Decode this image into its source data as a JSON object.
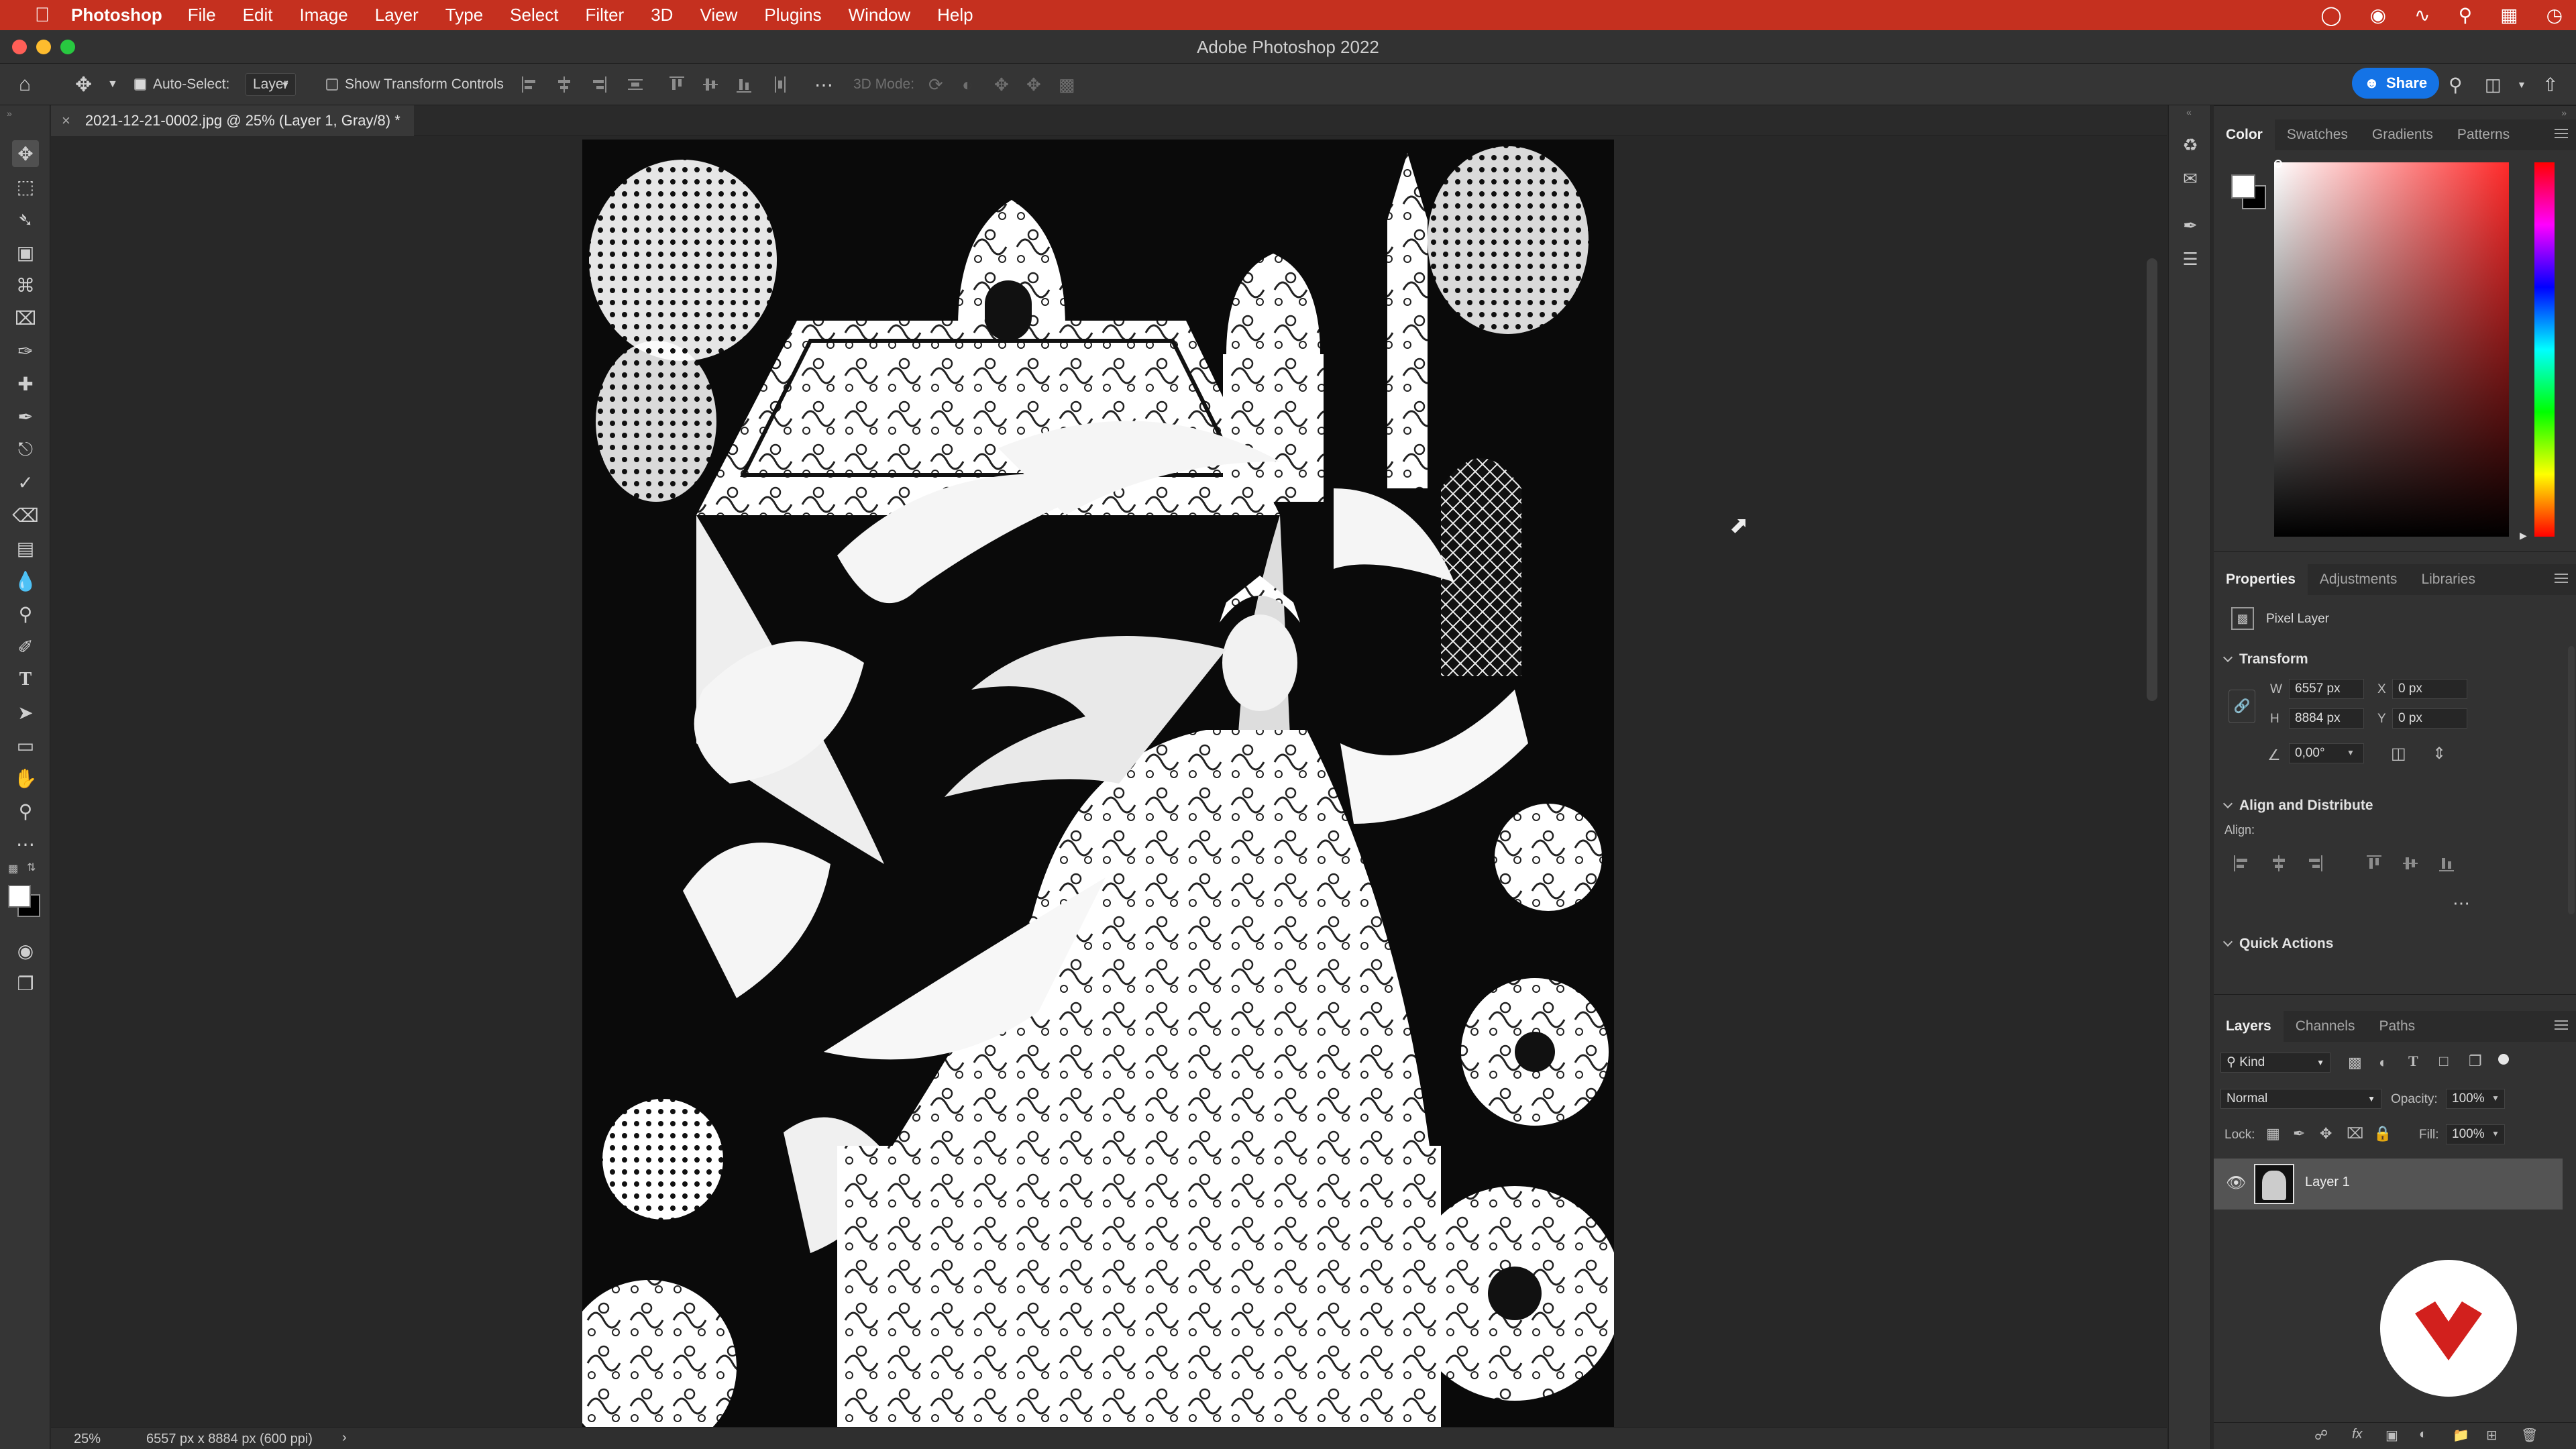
{
  "menubar": {
    "app_name": "Photoshop",
    "items": [
      "File",
      "Edit",
      "Image",
      "Layer",
      "Type",
      "Select",
      "Filter",
      "3D",
      "View",
      "Plugins",
      "Window",
      "Help"
    ]
  },
  "window": {
    "title": "Adobe Photoshop 2022"
  },
  "options": {
    "auto_select_label": "Auto-Select:",
    "auto_select_checked": true,
    "auto_select_target": "Layer",
    "show_transform_label": "Show Transform Controls",
    "mode_3d_label": "3D Mode:",
    "share_label": "Share"
  },
  "document": {
    "tab_title": "2021-12-21-0002.jpg @ 25% (Layer 1, Gray/8) *",
    "zoom": "25%",
    "dimensions": "6557 px x 8884 px (600 ppi)"
  },
  "color_panel": {
    "tabs": [
      "Color",
      "Swatches",
      "Gradients",
      "Patterns"
    ],
    "active_tab": "Color",
    "foreground": "#ffffff",
    "background": "#000000",
    "hue": "#ff2a2a"
  },
  "properties_panel": {
    "tabs": [
      "Properties",
      "Adjustments",
      "Libraries"
    ],
    "layer_kind": "Pixel Layer",
    "transform_title": "Transform",
    "w_label": "W",
    "w_value": "6557 px",
    "h_label": "H",
    "h_value": "8884 px",
    "x_label": "X",
    "x_value": "0 px",
    "y_label": "Y",
    "y_value": "0 px",
    "angle_value": "0,00°",
    "align_title": "Align and Distribute",
    "align_label": "Align:",
    "quick_actions_title": "Quick Actions"
  },
  "layers_panel": {
    "tabs": [
      "Layers",
      "Channels",
      "Paths"
    ],
    "filter_kind": "Kind",
    "blend_mode": "Normal",
    "opacity_label": "Opacity:",
    "opacity_value": "100%",
    "lock_label": "Lock:",
    "fill_label": "Fill:",
    "fill_value": "100%",
    "layers": [
      {
        "name": "Layer 1",
        "visible": true
      }
    ]
  },
  "colors": {
    "menubar": "#c5301f",
    "accent": "#1473e6",
    "badge": "#d2201d"
  }
}
